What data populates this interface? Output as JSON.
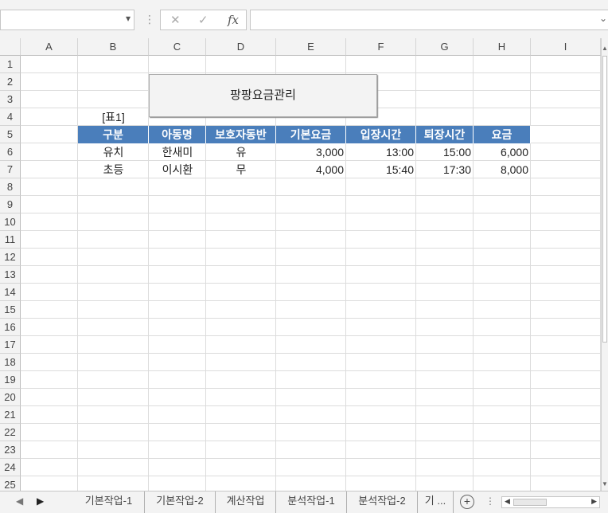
{
  "formula_bar": {
    "namebox_value": "",
    "cancel_icon": "✕",
    "enter_icon": "✓",
    "fx_label": "fx",
    "formula_value": ""
  },
  "columns": [
    "A",
    "B",
    "C",
    "D",
    "E",
    "F",
    "G",
    "H",
    "I"
  ],
  "rows": [
    "1",
    "2",
    "3",
    "4",
    "5",
    "6",
    "7",
    "8",
    "9",
    "10",
    "11",
    "12",
    "13",
    "14",
    "15",
    "16",
    "17",
    "18",
    "19",
    "20",
    "21",
    "22",
    "23",
    "24",
    "25"
  ],
  "sheet": {
    "button_label": "팡팡요금관리",
    "table_caption": "[표1]",
    "headers": [
      "구분",
      "아동명",
      "보호자동반",
      "기본요금",
      "입장시간",
      "퇴장시간",
      "요금"
    ],
    "data_rows": [
      [
        "유치",
        "한새미",
        "유",
        "3,000",
        "13:00",
        "15:00",
        "6,000"
      ],
      [
        "초등",
        "이시환",
        "무",
        "4,000",
        "15:40",
        "17:30",
        "8,000"
      ]
    ],
    "header_color": "#4a7ebb"
  },
  "tabs": {
    "items": [
      "기본작업-1",
      "기본작업-2",
      "계산작업",
      "분석작업-1",
      "분석작업-2",
      "기 ..."
    ],
    "prev_icon": "◀",
    "next_icon": "▶",
    "add_icon": "+"
  }
}
